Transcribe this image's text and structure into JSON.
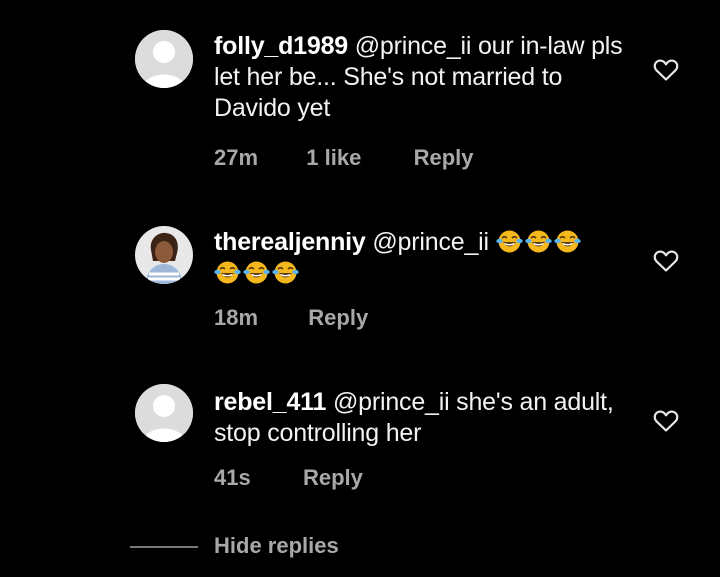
{
  "comments": [
    {
      "username": "folly_d1989",
      "text": "@prince_ii our in-law pls let her be... She's not married to Davido yet",
      "time": "27m",
      "likes": "1 like",
      "reply": "Reply",
      "avatar": "default-avatar"
    },
    {
      "username": "therealjenniy",
      "text": "@prince_ii",
      "emojis": [
        "face-with-tears-of-joy",
        "face-with-tears-of-joy",
        "face-with-tears-of-joy",
        "face-with-tears-of-joy",
        "face-with-tears-of-joy",
        "face-with-tears-of-joy"
      ],
      "time": "18m",
      "reply": "Reply",
      "avatar": "photo-avatar"
    },
    {
      "username": "rebel_411",
      "text": "@prince_ii she's an adult, stop controlling her",
      "time": "41s",
      "reply": "Reply",
      "avatar": "default-avatar"
    }
  ],
  "hide_replies": "Hide replies",
  "icons": {
    "like": "heart-outline-icon",
    "emoji": "face-with-tears-of-joy"
  },
  "colors": {
    "background": "#000000",
    "text": "#ffffff",
    "meta": "#a8a8a8",
    "emoji": "#f5b81c"
  }
}
